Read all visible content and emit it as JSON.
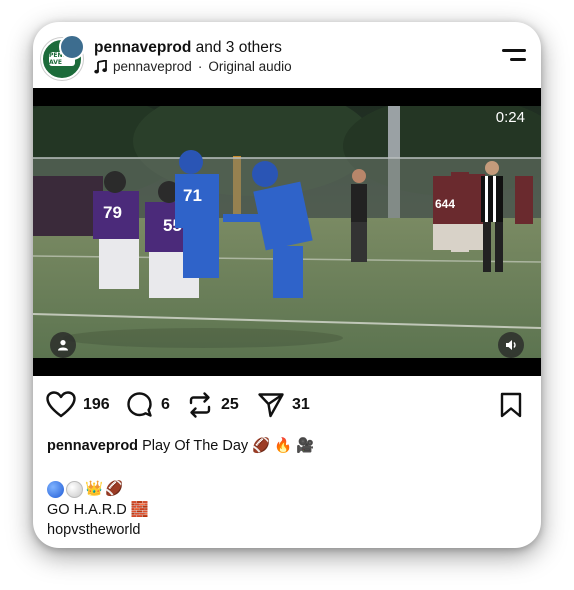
{
  "post": {
    "username": "pennaveprod",
    "coauthors_text": "and 3 others",
    "audio_owner": "pennaveprod",
    "audio_separator": "·",
    "audio_label": "Original audio",
    "avatar_badge": "PENN AVE"
  },
  "video": {
    "time_remaining": "0:24",
    "jersey_numbers": [
      "79",
      "71",
      "55",
      "644"
    ]
  },
  "actions": {
    "likes": "196",
    "comments": "6",
    "reposts": "25",
    "shares": "31"
  },
  "caption": {
    "username": "pennaveprod",
    "text": "Play Of The Day",
    "line3": "GO H.A.R.D",
    "line4": "hopvstheworld"
  },
  "colors": {
    "text": "#111111",
    "video_bg": "#000000",
    "field": "#4d6b4a",
    "team_blue": "#2f63c9",
    "team_purple": "#4b2a7a",
    "team_maroon": "#6a2a2e"
  },
  "icons": [
    "music-note-icon",
    "more-menu-icon",
    "user-tag-icon",
    "mute-icon",
    "heart-icon",
    "comment-icon",
    "repost-icon",
    "share-icon",
    "bookmark-icon"
  ]
}
